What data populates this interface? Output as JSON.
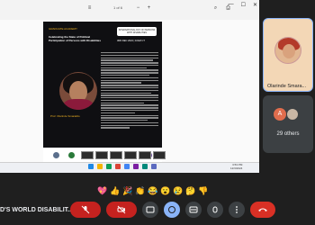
{
  "window": {
    "title": "1 of 6"
  },
  "document": {
    "org_line": "GRADUATE ACADEMY",
    "headline": "Celebrating the State of Political Participation of Persons with Disabilities",
    "badge_text": "INTERNATIONAL DAY OF PERSONS WITH DISABILITIES",
    "date_info": "3RD DEC 2024 | 10AM CT",
    "speaker": "Prof. Olarinde Smarakilo"
  },
  "taskbar": {
    "time": "3:53 PM",
    "date": "12/3/2024"
  },
  "participants": {
    "main_name": "Olarinde Smara...",
    "others_initial": "A",
    "others_count": "29 others"
  },
  "reactions": [
    "💖",
    "👍",
    "🎉",
    "👏",
    "😂",
    "😮",
    "😢",
    "🤔",
    "👎"
  ],
  "meeting": {
    "title": "D'S WORLD DISABILIT..."
  },
  "controls": {
    "mic": "mic-off-icon",
    "camera": "camera-off-icon",
    "captions": "captions-icon",
    "emoji": "emoji-icon",
    "present": "present-icon",
    "raise_hand": "hand-icon",
    "more": "more-icon",
    "end_call": "end-call-icon"
  },
  "colors": {
    "end_call": "#d93025",
    "active": "#8ab4f8",
    "muted": "#c5221f"
  }
}
